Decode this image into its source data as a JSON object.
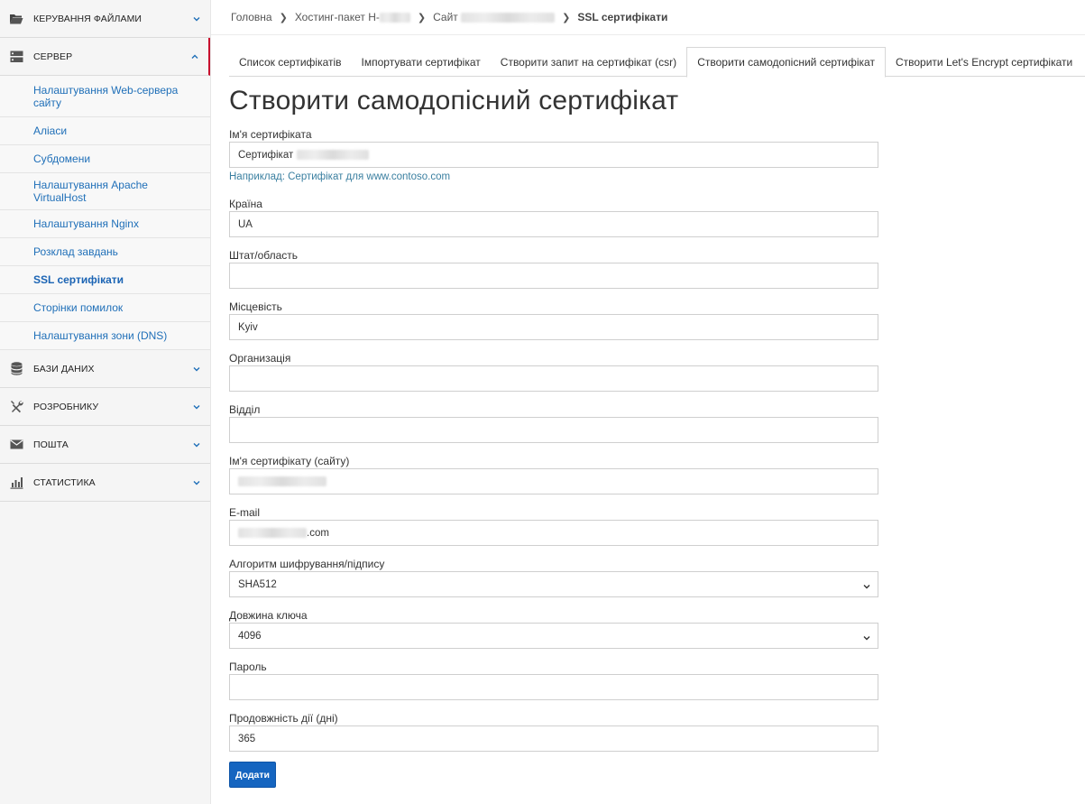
{
  "sidebar": {
    "sections": {
      "files": {
        "title": "Керування файлами",
        "icon": "folder-icon"
      },
      "server": {
        "title": "Сервер",
        "icon": "server-icon"
      },
      "databases": {
        "title": "Бази даних",
        "icon": "database-icon"
      },
      "developer": {
        "title": "Розробнику",
        "icon": "tools-icon"
      },
      "mail": {
        "title": "Пошта",
        "icon": "envelope-icon"
      },
      "stats": {
        "title": "Статистика",
        "icon": "bar-chart-icon"
      }
    },
    "server_items": [
      {
        "label": "Налаштування Web-сервера сайту"
      },
      {
        "label": "Аліаси"
      },
      {
        "label": "Субдомени"
      },
      {
        "label": "Налаштування Apache VirtualHost"
      },
      {
        "label": "Налаштування Nginx"
      },
      {
        "label": "Розклад завдань"
      },
      {
        "label": "SSL сертифікати",
        "active": true
      },
      {
        "label": "Сторінки помилок"
      },
      {
        "label": "Налаштування зони (DNS)"
      }
    ]
  },
  "breadcrumb": {
    "home": "Головна",
    "package": "Хостинг-пакет H-",
    "site": "Сайт",
    "current": "SSL сертифікати"
  },
  "tabs": [
    {
      "label": "Список сертифікатів"
    },
    {
      "label": "Імпортувати сертифікат"
    },
    {
      "label": "Створити запит на сертифікат (csr)"
    },
    {
      "label": "Створити самодопісний сертифікат",
      "active": true
    },
    {
      "label": "Створити Let's Encrypt сертифікати"
    }
  ],
  "page_title": "Створити самодопісний сертифікат",
  "form": {
    "cert_name": {
      "label": "Ім'я сертифіката",
      "value": "Сертифікат",
      "hint": "Наприклад: Сертифікат для www.contoso.com"
    },
    "country": {
      "label": "Країна",
      "value": "UA"
    },
    "state": {
      "label": "Штат/область",
      "value": ""
    },
    "locality": {
      "label": "Місцевість",
      "value": "Kyiv"
    },
    "organization": {
      "label": "Организація",
      "value": ""
    },
    "department": {
      "label": "Відділ",
      "value": ""
    },
    "common_name": {
      "label": "Ім'я сертифікату (сайту)",
      "value": ""
    },
    "email": {
      "label": "E-mail",
      "value": ".com"
    },
    "algorithm": {
      "label": "Алгоритм шифрування/підпису",
      "value": "SHA512"
    },
    "key_length": {
      "label": "Довжина ключа",
      "value": "4096"
    },
    "password": {
      "label": "Пароль",
      "value": ""
    },
    "validity": {
      "label": "Продовжність дії (дні)",
      "value": "365"
    },
    "submit_label": "Додати"
  },
  "colors": {
    "link": "#1f6fb8",
    "accent_red": "#c8102e",
    "button": "#1565c0",
    "hint": "#3a7fa0"
  }
}
